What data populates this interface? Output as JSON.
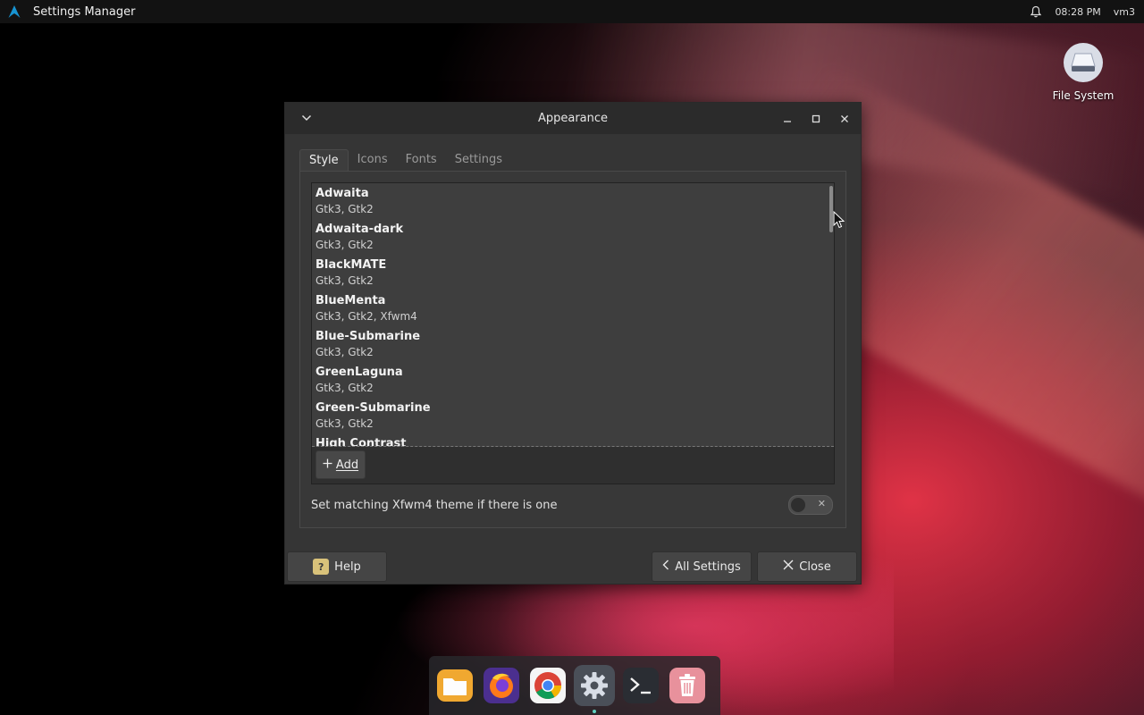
{
  "panel": {
    "app_title": "Settings Manager",
    "time": "08:28 PM",
    "user": "vm3"
  },
  "desktop": {
    "icon_label": "File System"
  },
  "window": {
    "title": "Appearance",
    "tabs": [
      {
        "label": "Style",
        "active": true
      },
      {
        "label": "Icons",
        "active": false
      },
      {
        "label": "Fonts",
        "active": false
      },
      {
        "label": "Settings",
        "active": false
      }
    ],
    "themes": [
      {
        "name": "Adwaita",
        "sub": "Gtk3, Gtk2"
      },
      {
        "name": "Adwaita-dark",
        "sub": "Gtk3, Gtk2"
      },
      {
        "name": "BlackMATE",
        "sub": "Gtk3, Gtk2"
      },
      {
        "name": "BlueMenta",
        "sub": "Gtk3, Gtk2, Xfwm4"
      },
      {
        "name": "Blue-Submarine",
        "sub": "Gtk3, Gtk2"
      },
      {
        "name": "GreenLaguna",
        "sub": "Gtk3, Gtk2"
      },
      {
        "name": "Green-Submarine",
        "sub": "Gtk3, Gtk2"
      },
      {
        "name": "High Contrast",
        "sub": ""
      }
    ],
    "add_label": "Add",
    "match_label": "Set matching Xfwm4 theme if there is one",
    "match_toggle_on": false,
    "buttons": {
      "help": "Help",
      "all_settings": "All Settings",
      "close": "Close"
    }
  },
  "dock": {
    "items": [
      "files-icon",
      "firefox-icon",
      "chrome-icon",
      "settings-icon",
      "terminal-icon",
      "trash-icon"
    ],
    "active": "settings-icon"
  },
  "colors": {
    "accent": "#5fd0c0",
    "panel_bg": "#121212",
    "window_bg": "#353535"
  }
}
